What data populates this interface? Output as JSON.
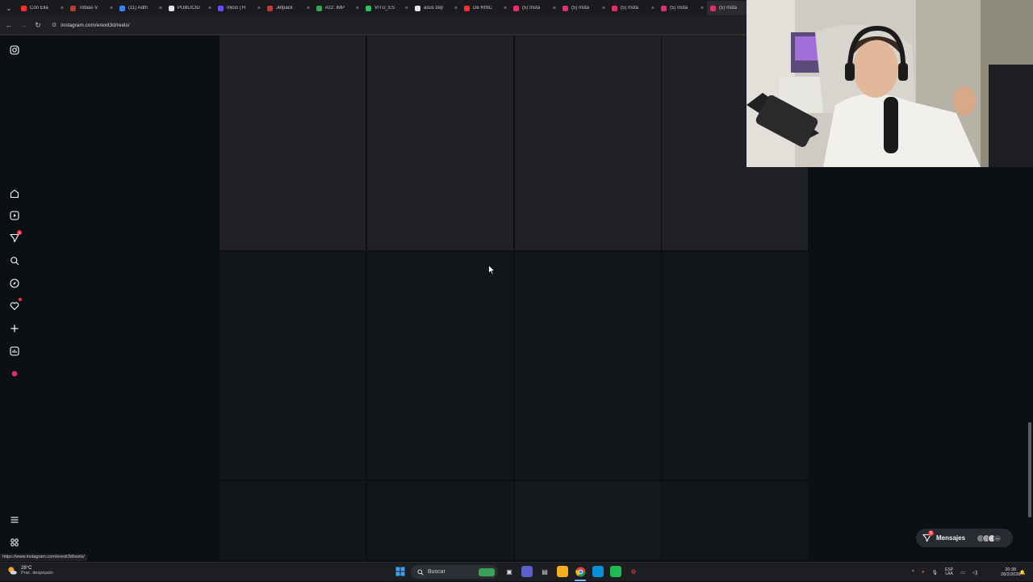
{
  "browser": {
    "tabs": [
      {
        "label": "Con Ella",
        "color": "#ff2d2d"
      },
      {
        "label": "Tobias V.",
        "color": "#c0392b"
      },
      {
        "label": "(11) Adm",
        "color": "#3b82f6"
      },
      {
        "label": "PUBLICID",
        "color": "#e5e5e5"
      },
      {
        "label": "Inicio | H",
        "color": "#6d4aff"
      },
      {
        "label": "Jetpack",
        "color": "#c0392b"
      },
      {
        "label": "#22: IMP",
        "color": "#34a853"
      },
      {
        "label": "VITU_ES",
        "color": "#22c55e"
      },
      {
        "label": "asus zep",
        "color": "#e5e5e5"
      },
      {
        "label": "De RINC",
        "color": "#ff2d2d"
      },
      {
        "label": "(5) Insta",
        "color": "#e1306c"
      },
      {
        "label": "(5) Insta",
        "color": "#e1306c"
      },
      {
        "label": "(5) Insta",
        "color": "#e1306c"
      },
      {
        "label": "(5) Insta",
        "color": "#e1306c"
      },
      {
        "label": "(5) Insta",
        "color": "#e1306c"
      }
    ],
    "url": "instagram.com/erexit3d/reels/",
    "status_url": "https://www.instagram.com/erexit3d/reels/"
  },
  "sidebar": {
    "notifications_badge": "3"
  },
  "messages": {
    "label": "Mensajes",
    "badge": "5"
  },
  "taskbar": {
    "weather_temp": "28°C",
    "weather_desc": "Prac. despejado",
    "search_placeholder": "Buscar",
    "lang_top": "ESP",
    "lang_bottom": "LAA",
    "time": "20:38",
    "date": "28/2/2026"
  },
  "colors": {
    "page_bg": "#0c0f14",
    "tile": "#1f2124",
    "tile_dark": "#121519",
    "accent": "#ff3040"
  }
}
